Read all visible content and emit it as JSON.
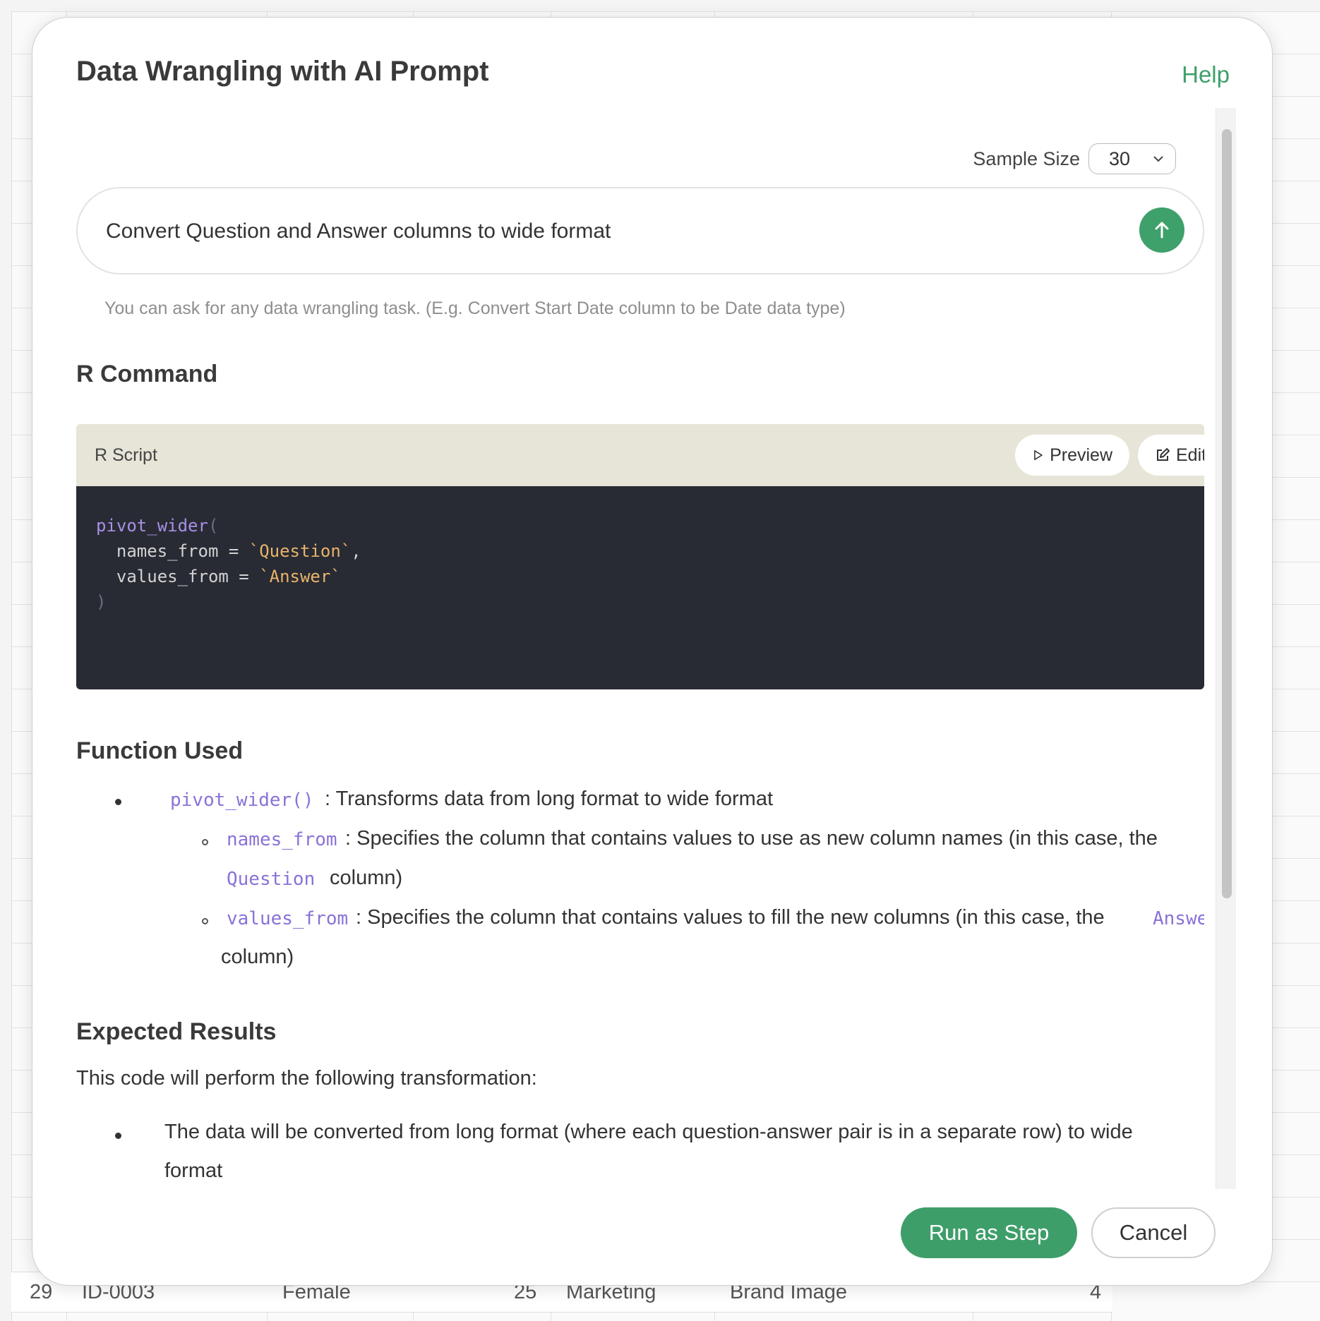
{
  "background_row": {
    "row_number": "29",
    "id": "ID-0003",
    "gender": "Female",
    "age": "25",
    "department": "Marketing",
    "question": "Brand Image",
    "answer": "4"
  },
  "modal": {
    "title": "Data Wrangling with AI Prompt",
    "help_label": "Help"
  },
  "sample": {
    "label": "Sample Size",
    "value": "30"
  },
  "prompt": {
    "text": "Convert Question and Answer columns to wide format",
    "hint": "You can ask for any data wrangling task. (E.g. Convert Start Date column to be Date data type)"
  },
  "r_command": {
    "heading": "R Command",
    "script_label": "R Script",
    "preview_label": "Preview",
    "edit_label": "Edit",
    "code": {
      "fn": "pivot_wider",
      "open": "(",
      "arg1_name": "  names_from = ",
      "arg1_value": "`Question`",
      "arg1_sep": ",",
      "arg2_name": "  values_from = ",
      "arg2_value": "`Answer`",
      "close": ")"
    }
  },
  "function_used": {
    "heading": "Function Used",
    "main_fn": "pivot_wider()",
    "main_desc": ": Transforms data from long format to wide format",
    "param1_name": "names_from",
    "param1_desc": ": Specifies the column that contains values to use as new column names (in this case, the",
    "param1_col": "Question",
    "param1_tail": "column)",
    "param2_name": "values_from",
    "param2_desc": ": Specifies the column that contains values to fill the new columns (in this case, the",
    "param2_col": "Answer",
    "param2_tail": "column)"
  },
  "expected": {
    "heading": "Expected Results",
    "intro": "This code will perform the following transformation:",
    "bullet1_line1": "The data will be converted from long format (where each question-answer pair is in a separate row) to wide",
    "bullet1_line2": "format"
  },
  "footer": {
    "run_label": "Run as Step",
    "cancel_label": "Cancel"
  },
  "colors": {
    "accent": "#3ea06a",
    "code_bg": "#282b34",
    "script_header_bg": "#e7e4d8",
    "code_fn": "#a98fe6",
    "code_string": "#e9b36a"
  }
}
